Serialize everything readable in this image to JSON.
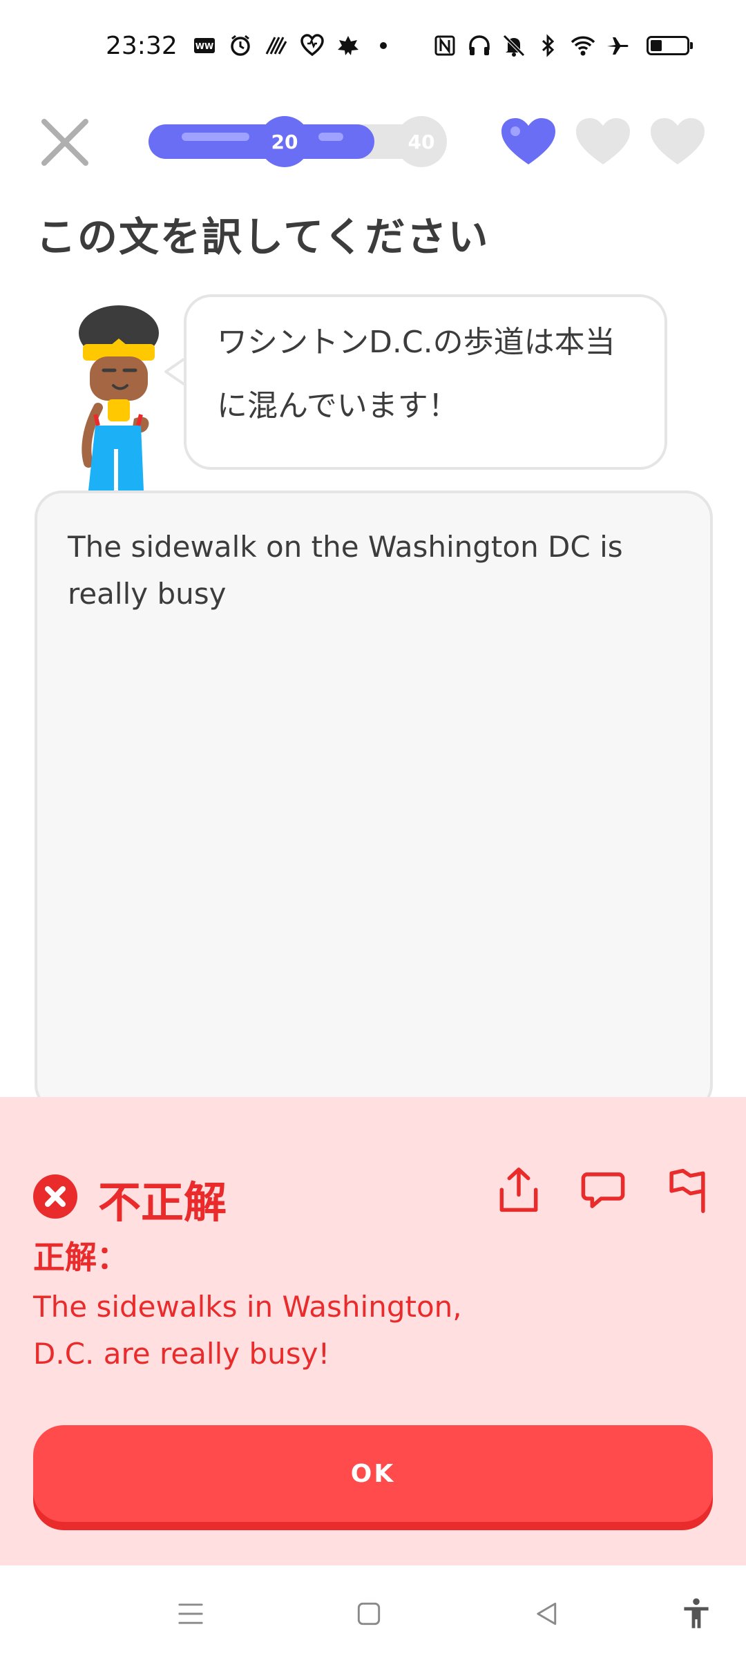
{
  "status_bar": {
    "time": "23:32",
    "left_icons": [
      "app-icon-ww",
      "clock-icon",
      "pattern-icon",
      "heart-pulse-icon",
      "leaf-icon"
    ],
    "right_icons": [
      "nfc-icon",
      "headphones-icon",
      "mute-icon",
      "bluetooth-icon",
      "wifi-icon",
      "airplane-icon",
      "battery-icon"
    ]
  },
  "lesson": {
    "progress_fraction": 0.76,
    "milestone_current": "20",
    "milestone_next": "40",
    "hearts_total": 3,
    "hearts_filled": 1,
    "colors": {
      "progress": "#6a6ef5",
      "heart_filled": "#6a6ef5",
      "heart_empty": "#e5e5e5"
    }
  },
  "prompt": {
    "instruction": "この文を訳してください",
    "sentence_line1": "ワシントンD.C.の歩道は本当",
    "sentence_line2": "に混んでいます！"
  },
  "answer": {
    "text": "The sidewalk on the Washington DC is really busy"
  },
  "feedback": {
    "title": "不正解",
    "label": "正解：",
    "solution": "The sidewalks in Washington, D.C. are really busy!",
    "ok_label": "OK",
    "colors": {
      "background": "#ffdfe0",
      "text": "#ea2b2b",
      "button": "#ff4b4b"
    }
  },
  "nav_bar": {
    "icons": [
      "menu-icon",
      "home-square-icon",
      "back-triangle-icon",
      "accessibility-icon"
    ]
  }
}
